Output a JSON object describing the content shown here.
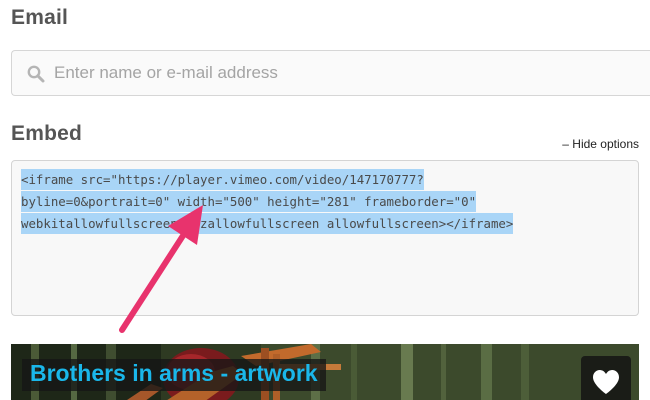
{
  "email": {
    "title": "Email",
    "placeholder": "Enter name or e-mail address",
    "icon": "search-icon"
  },
  "embed": {
    "title": "Embed",
    "hide_options_label": "– Hide options",
    "code_lines": [
      "<iframe src=\"https://player.vimeo.com/video/147170777?",
      "byline=0&portrait=0\" width=\"500\" height=\"281\" frameborder=\"0\"",
      "webkitallowfullscreen mozallowfullscreen allowfullscreen></iframe>"
    ],
    "selection_color": "#a9d5f7"
  },
  "annotation": {
    "arrow_color": "#e8336d"
  },
  "video": {
    "title": "Brothers in arms - artwork",
    "title_color": "#1ab7ea",
    "like_icon": "heart-icon"
  }
}
